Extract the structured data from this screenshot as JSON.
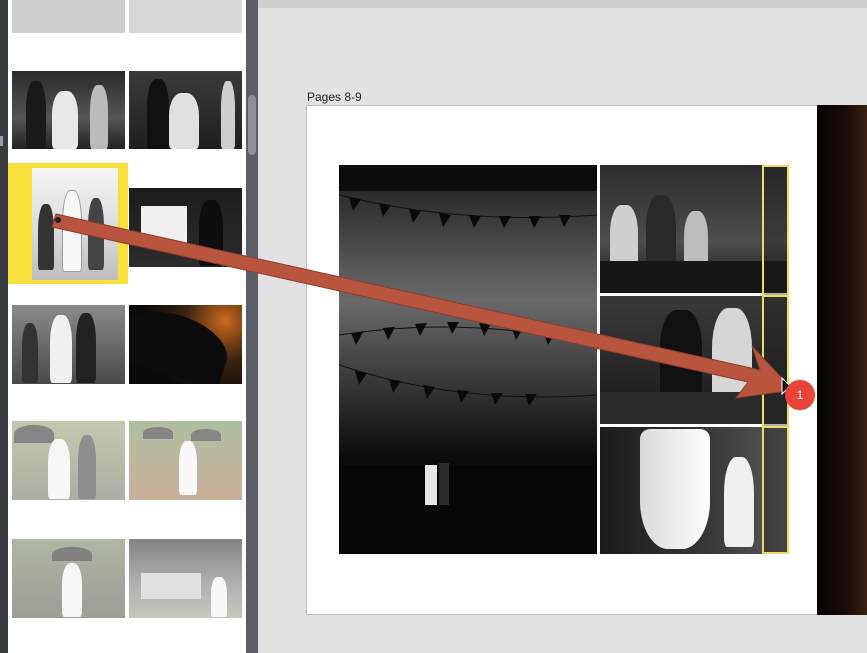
{
  "canvas": {
    "pages_label": "Pages 8-9"
  },
  "drag": {
    "count_badge": "1",
    "arrow_color": "#b9553f",
    "selection_color": "#f7e03a",
    "drop_highlight_color": "#f1dc63"
  }
}
